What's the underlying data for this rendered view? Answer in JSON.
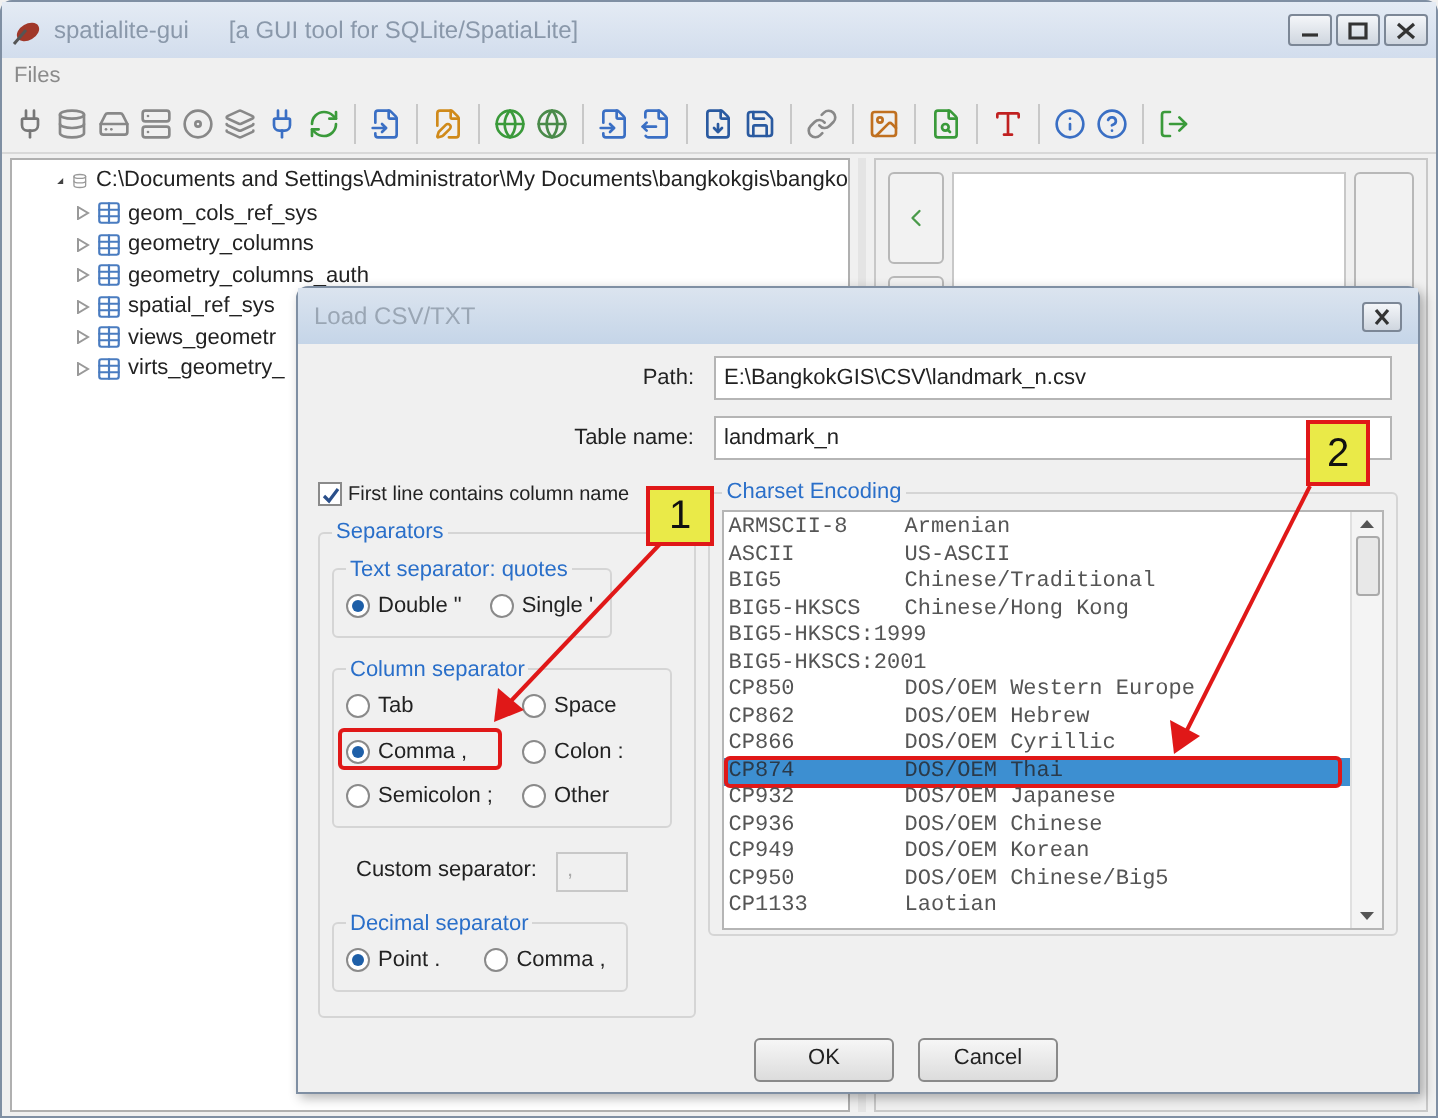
{
  "window": {
    "title": "spatialite-gui",
    "subtitle": "[a GUI tool for SQLite/SpatiaLite]"
  },
  "menu": [
    "Files"
  ],
  "tree": {
    "label": "C:\\Documents and Settings\\Administrator\\My Documents\\bangkokgis\\bangko",
    "expanded": true,
    "children": [
      {
        "label": "geom_cols_ref_sys",
        "expanded": false
      },
      {
        "label": "geometry_columns",
        "expanded": false
      },
      {
        "label": "geometry_columns_auth",
        "expanded": false
      },
      {
        "label": "spatial_ref_sys",
        "expanded": false
      },
      {
        "label": "views_geometr",
        "expanded": false
      },
      {
        "label": "virts_geometry_",
        "expanded": false
      }
    ]
  },
  "dialog": {
    "title": "Load CSV/TXT",
    "fields": [
      {
        "label": "Path:",
        "value": "E:\\BangkokGIS\\CSV\\landmark_n.csv"
      },
      {
        "label": "Table name:",
        "value": "landmark_n"
      }
    ],
    "first_line": {
      "label": "First line contains column name",
      "checked": true
    },
    "separators": {
      "title": "Separators",
      "text_separator": {
        "title": "Text separator: quotes",
        "options": [
          {
            "label": "Double \"",
            "selected": true
          },
          {
            "label": "Single '",
            "selected": false
          }
        ]
      },
      "column_separator": {
        "title": "Column separator",
        "options": [
          {
            "label": "Tab",
            "selected": false
          },
          {
            "label": "Space",
            "selected": false
          },
          {
            "label": "Comma ,",
            "selected": true
          },
          {
            "label": "Colon :",
            "selected": false
          },
          {
            "label": "Semicolon ;",
            "selected": false
          },
          {
            "label": "Other",
            "selected": false
          }
        ]
      },
      "custom_separator": {
        "label": "Custom separator:",
        "value": ",",
        "disabled": true
      },
      "decimal_separator": {
        "title": "Decimal separator",
        "options": [
          {
            "label": "Point .",
            "selected": true
          },
          {
            "label": "Comma ,",
            "selected": false
          }
        ]
      }
    },
    "charset": {
      "title": "Charset Encoding",
      "items": [
        {
          "code": "ARMSCII-8",
          "name": "Armenian",
          "selected": false
        },
        {
          "code": "ASCII",
          "name": "US-ASCII",
          "selected": false
        },
        {
          "code": "BIG5",
          "name": "Chinese/Traditional",
          "selected": false
        },
        {
          "code": "BIG5-HKSCS",
          "name": "Chinese/Hong Kong",
          "selected": false
        },
        {
          "code": "BIG5-HKSCS:1999",
          "selected": false
        },
        {
          "code": "BIG5-HKSCS:2001",
          "selected": false
        },
        {
          "code": "CP850",
          "name": "DOS/OEM Western Europe",
          "selected": false
        },
        {
          "code": "CP862",
          "name": "DOS/OEM Hebrew",
          "selected": false
        },
        {
          "code": "CP866",
          "name": "DOS/OEM Cyrillic",
          "selected": false
        },
        {
          "code": "CP874",
          "name": "DOS/OEM Thai",
          "selected": true
        },
        {
          "code": "CP932",
          "name": "DOS/OEM Japanese",
          "selected": false
        },
        {
          "code": "CP936",
          "name": "DOS/OEM Chinese",
          "selected": false
        },
        {
          "code": "CP949",
          "name": "DOS/OEM Korean",
          "selected": false
        },
        {
          "code": "CP950",
          "name": "DOS/OEM Chinese/Big5",
          "selected": false
        },
        {
          "code": "CP1133",
          "name": "Laotian",
          "selected": false
        }
      ]
    },
    "buttons": [
      "OK",
      "Cancel"
    ]
  },
  "callouts": [
    "1",
    "2"
  ]
}
